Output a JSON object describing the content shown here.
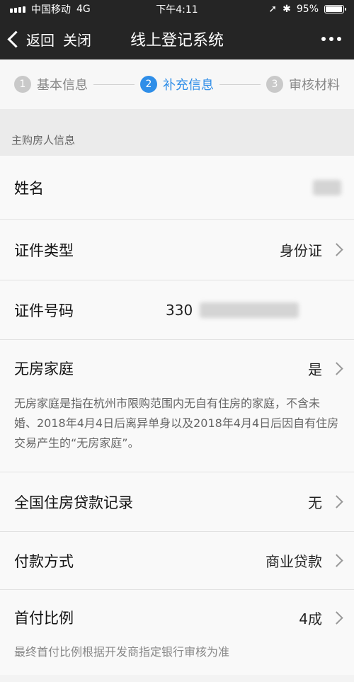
{
  "status": {
    "carrier": "中国移动",
    "network": "4G",
    "time": "下午4:11",
    "battery": "95%",
    "battery_level": 0.95
  },
  "nav": {
    "back": "返回",
    "close": "关闭",
    "title": "线上登记系统"
  },
  "steps": [
    {
      "num": "1",
      "label": "基本信息"
    },
    {
      "num": "2",
      "label": "补充信息"
    },
    {
      "num": "3",
      "label": "审核材料"
    }
  ],
  "section": {
    "title": "主购房人信息"
  },
  "fields": {
    "name": {
      "label": "姓名"
    },
    "id_type": {
      "label": "证件类型",
      "value": "身份证"
    },
    "id_number": {
      "label": "证件号码",
      "value": "330"
    },
    "no_house": {
      "label": "无房家庭",
      "value": "是",
      "note": "无房家庭是指在杭州市限购范围内无自有住房的家庭，不含未婚、2018年4月4日后离异单身以及2018年4月4日后因自有住房交易产生的“无房家庭”。"
    },
    "loan_record": {
      "label": "全国住房贷款记录",
      "value": "无"
    },
    "payment": {
      "label": "付款方式",
      "value": "商业贷款"
    },
    "down_payment": {
      "label": "首付比例",
      "value": "4成",
      "note": "最终首付比例根据开发商指定银行审核为准"
    }
  }
}
